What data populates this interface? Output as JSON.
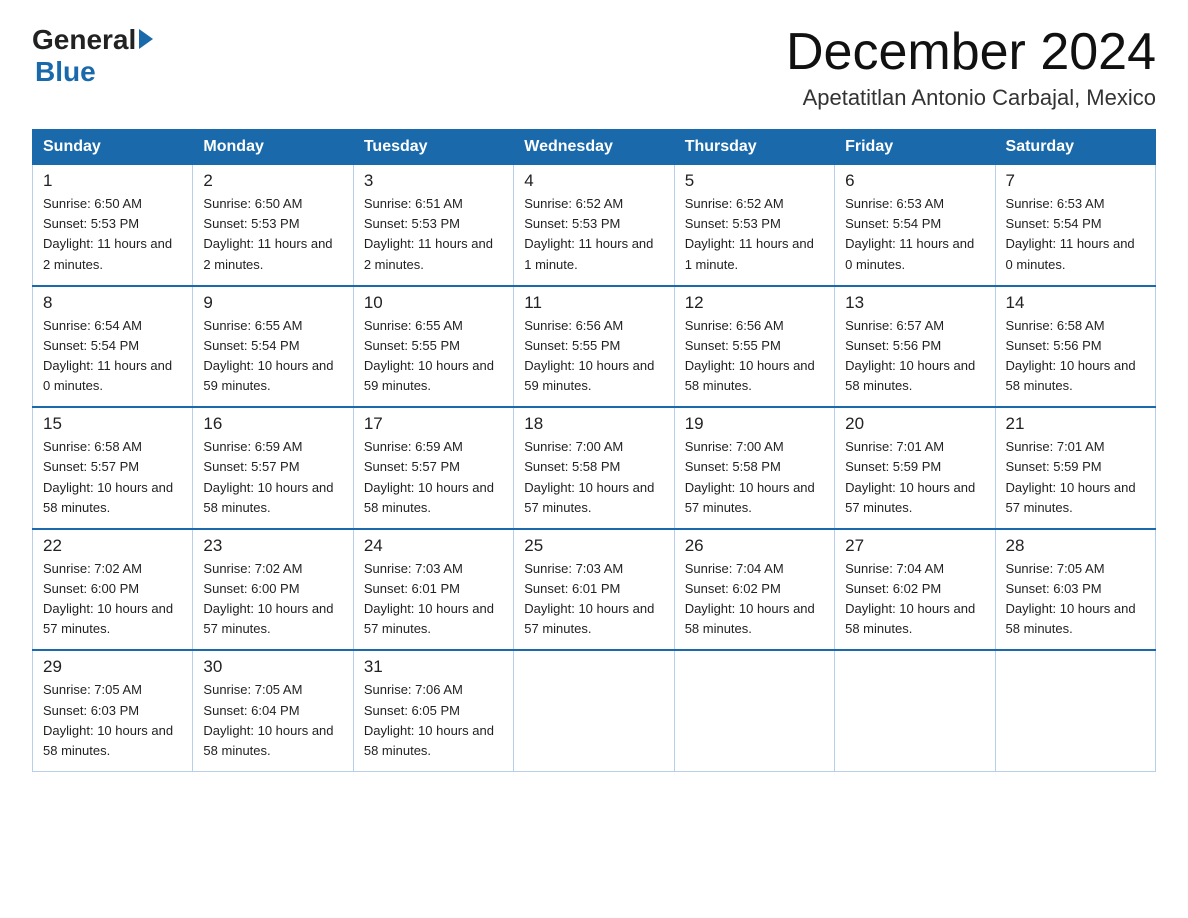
{
  "header": {
    "logo": {
      "text_general": "General",
      "text_blue": "Blue"
    },
    "month_title": "December 2024",
    "location": "Apetatitlan Antonio Carbajal, Mexico"
  },
  "days_of_week": [
    "Sunday",
    "Monday",
    "Tuesday",
    "Wednesday",
    "Thursday",
    "Friday",
    "Saturday"
  ],
  "weeks": [
    [
      {
        "day": "1",
        "sunrise": "6:50 AM",
        "sunset": "5:53 PM",
        "daylight": "11 hours and 2 minutes."
      },
      {
        "day": "2",
        "sunrise": "6:50 AM",
        "sunset": "5:53 PM",
        "daylight": "11 hours and 2 minutes."
      },
      {
        "day": "3",
        "sunrise": "6:51 AM",
        "sunset": "5:53 PM",
        "daylight": "11 hours and 2 minutes."
      },
      {
        "day": "4",
        "sunrise": "6:52 AM",
        "sunset": "5:53 PM",
        "daylight": "11 hours and 1 minute."
      },
      {
        "day": "5",
        "sunrise": "6:52 AM",
        "sunset": "5:53 PM",
        "daylight": "11 hours and 1 minute."
      },
      {
        "day": "6",
        "sunrise": "6:53 AM",
        "sunset": "5:54 PM",
        "daylight": "11 hours and 0 minutes."
      },
      {
        "day": "7",
        "sunrise": "6:53 AM",
        "sunset": "5:54 PM",
        "daylight": "11 hours and 0 minutes."
      }
    ],
    [
      {
        "day": "8",
        "sunrise": "6:54 AM",
        "sunset": "5:54 PM",
        "daylight": "11 hours and 0 minutes."
      },
      {
        "day": "9",
        "sunrise": "6:55 AM",
        "sunset": "5:54 PM",
        "daylight": "10 hours and 59 minutes."
      },
      {
        "day": "10",
        "sunrise": "6:55 AM",
        "sunset": "5:55 PM",
        "daylight": "10 hours and 59 minutes."
      },
      {
        "day": "11",
        "sunrise": "6:56 AM",
        "sunset": "5:55 PM",
        "daylight": "10 hours and 59 minutes."
      },
      {
        "day": "12",
        "sunrise": "6:56 AM",
        "sunset": "5:55 PM",
        "daylight": "10 hours and 58 minutes."
      },
      {
        "day": "13",
        "sunrise": "6:57 AM",
        "sunset": "5:56 PM",
        "daylight": "10 hours and 58 minutes."
      },
      {
        "day": "14",
        "sunrise": "6:58 AM",
        "sunset": "5:56 PM",
        "daylight": "10 hours and 58 minutes."
      }
    ],
    [
      {
        "day": "15",
        "sunrise": "6:58 AM",
        "sunset": "5:57 PM",
        "daylight": "10 hours and 58 minutes."
      },
      {
        "day": "16",
        "sunrise": "6:59 AM",
        "sunset": "5:57 PM",
        "daylight": "10 hours and 58 minutes."
      },
      {
        "day": "17",
        "sunrise": "6:59 AM",
        "sunset": "5:57 PM",
        "daylight": "10 hours and 58 minutes."
      },
      {
        "day": "18",
        "sunrise": "7:00 AM",
        "sunset": "5:58 PM",
        "daylight": "10 hours and 57 minutes."
      },
      {
        "day": "19",
        "sunrise": "7:00 AM",
        "sunset": "5:58 PM",
        "daylight": "10 hours and 57 minutes."
      },
      {
        "day": "20",
        "sunrise": "7:01 AM",
        "sunset": "5:59 PM",
        "daylight": "10 hours and 57 minutes."
      },
      {
        "day": "21",
        "sunrise": "7:01 AM",
        "sunset": "5:59 PM",
        "daylight": "10 hours and 57 minutes."
      }
    ],
    [
      {
        "day": "22",
        "sunrise": "7:02 AM",
        "sunset": "6:00 PM",
        "daylight": "10 hours and 57 minutes."
      },
      {
        "day": "23",
        "sunrise": "7:02 AM",
        "sunset": "6:00 PM",
        "daylight": "10 hours and 57 minutes."
      },
      {
        "day": "24",
        "sunrise": "7:03 AM",
        "sunset": "6:01 PM",
        "daylight": "10 hours and 57 minutes."
      },
      {
        "day": "25",
        "sunrise": "7:03 AM",
        "sunset": "6:01 PM",
        "daylight": "10 hours and 57 minutes."
      },
      {
        "day": "26",
        "sunrise": "7:04 AM",
        "sunset": "6:02 PM",
        "daylight": "10 hours and 58 minutes."
      },
      {
        "day": "27",
        "sunrise": "7:04 AM",
        "sunset": "6:02 PM",
        "daylight": "10 hours and 58 minutes."
      },
      {
        "day": "28",
        "sunrise": "7:05 AM",
        "sunset": "6:03 PM",
        "daylight": "10 hours and 58 minutes."
      }
    ],
    [
      {
        "day": "29",
        "sunrise": "7:05 AM",
        "sunset": "6:03 PM",
        "daylight": "10 hours and 58 minutes."
      },
      {
        "day": "30",
        "sunrise": "7:05 AM",
        "sunset": "6:04 PM",
        "daylight": "10 hours and 58 minutes."
      },
      {
        "day": "31",
        "sunrise": "7:06 AM",
        "sunset": "6:05 PM",
        "daylight": "10 hours and 58 minutes."
      },
      null,
      null,
      null,
      null
    ]
  ]
}
